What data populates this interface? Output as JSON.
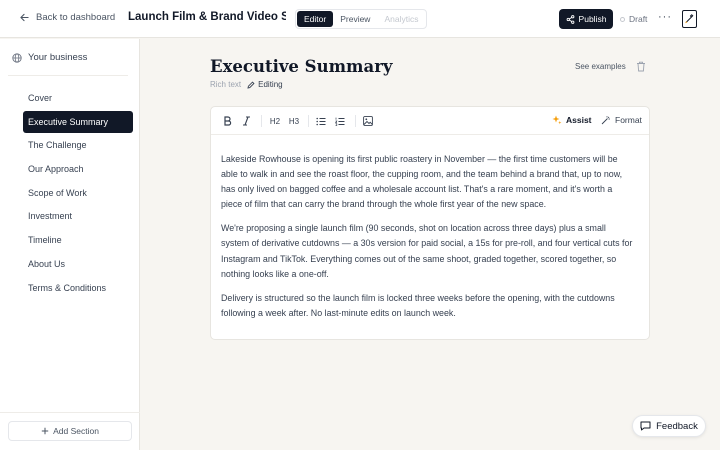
{
  "header": {
    "back_label": "Back to dashboard",
    "document_title": "Launch Film & Brand Video Syster",
    "view_tabs": [
      {
        "label": "Editor",
        "state": "active"
      },
      {
        "label": "Preview",
        "state": "normal"
      },
      {
        "label": "Analytics",
        "state": "disabled"
      }
    ],
    "publish_label": "Publish",
    "status_label": "Draft",
    "more_label": "···"
  },
  "sidebar": {
    "business_label": "Your business",
    "items": [
      {
        "label": "Cover"
      },
      {
        "label": "Executive Summary",
        "active": true
      },
      {
        "label": "The Challenge"
      },
      {
        "label": "Our Approach"
      },
      {
        "label": "Scope of Work"
      },
      {
        "label": "Investment"
      },
      {
        "label": "Timeline"
      },
      {
        "label": "About Us"
      },
      {
        "label": "Terms & Conditions"
      }
    ],
    "add_section_label": "Add Section"
  },
  "section": {
    "title": "Executive Summary",
    "type_label": "Rich text",
    "edit_label": "Editing",
    "see_examples_label": "See examples"
  },
  "toolbar": {
    "h2_label": "H2",
    "h3_label": "H3",
    "assist_label": "Assist",
    "format_label": "Format"
  },
  "content": {
    "paragraphs": [
      "Lakeside Rowhouse is opening its first public roastery in November — the first time customers will be able to walk in and see the roast floor, the cupping room, and the team behind a brand that, up to now, has only lived on bagged coffee and a wholesale account list. That's a rare moment, and it's worth a piece of film that can carry the brand through the whole first year of the new space.",
      "We're proposing a single launch film (90 seconds, shot on location across three days) plus a small system of derivative cutdowns — a 30s version for paid social, a 15s for pre-roll, and four vertical cuts for Instagram and TikTok. Everything comes out of the same shoot, graded together, scored together, so nothing looks like a one-off.",
      "Delivery is structured so the launch film is locked three weeks before the opening, with the cutdowns following a week after. No last-minute edits on launch week."
    ]
  },
  "feedback_label": "Feedback",
  "colors": {
    "ink": "#111827",
    "background": "#f7f5f1",
    "assist_accent": "#f59e0b"
  }
}
